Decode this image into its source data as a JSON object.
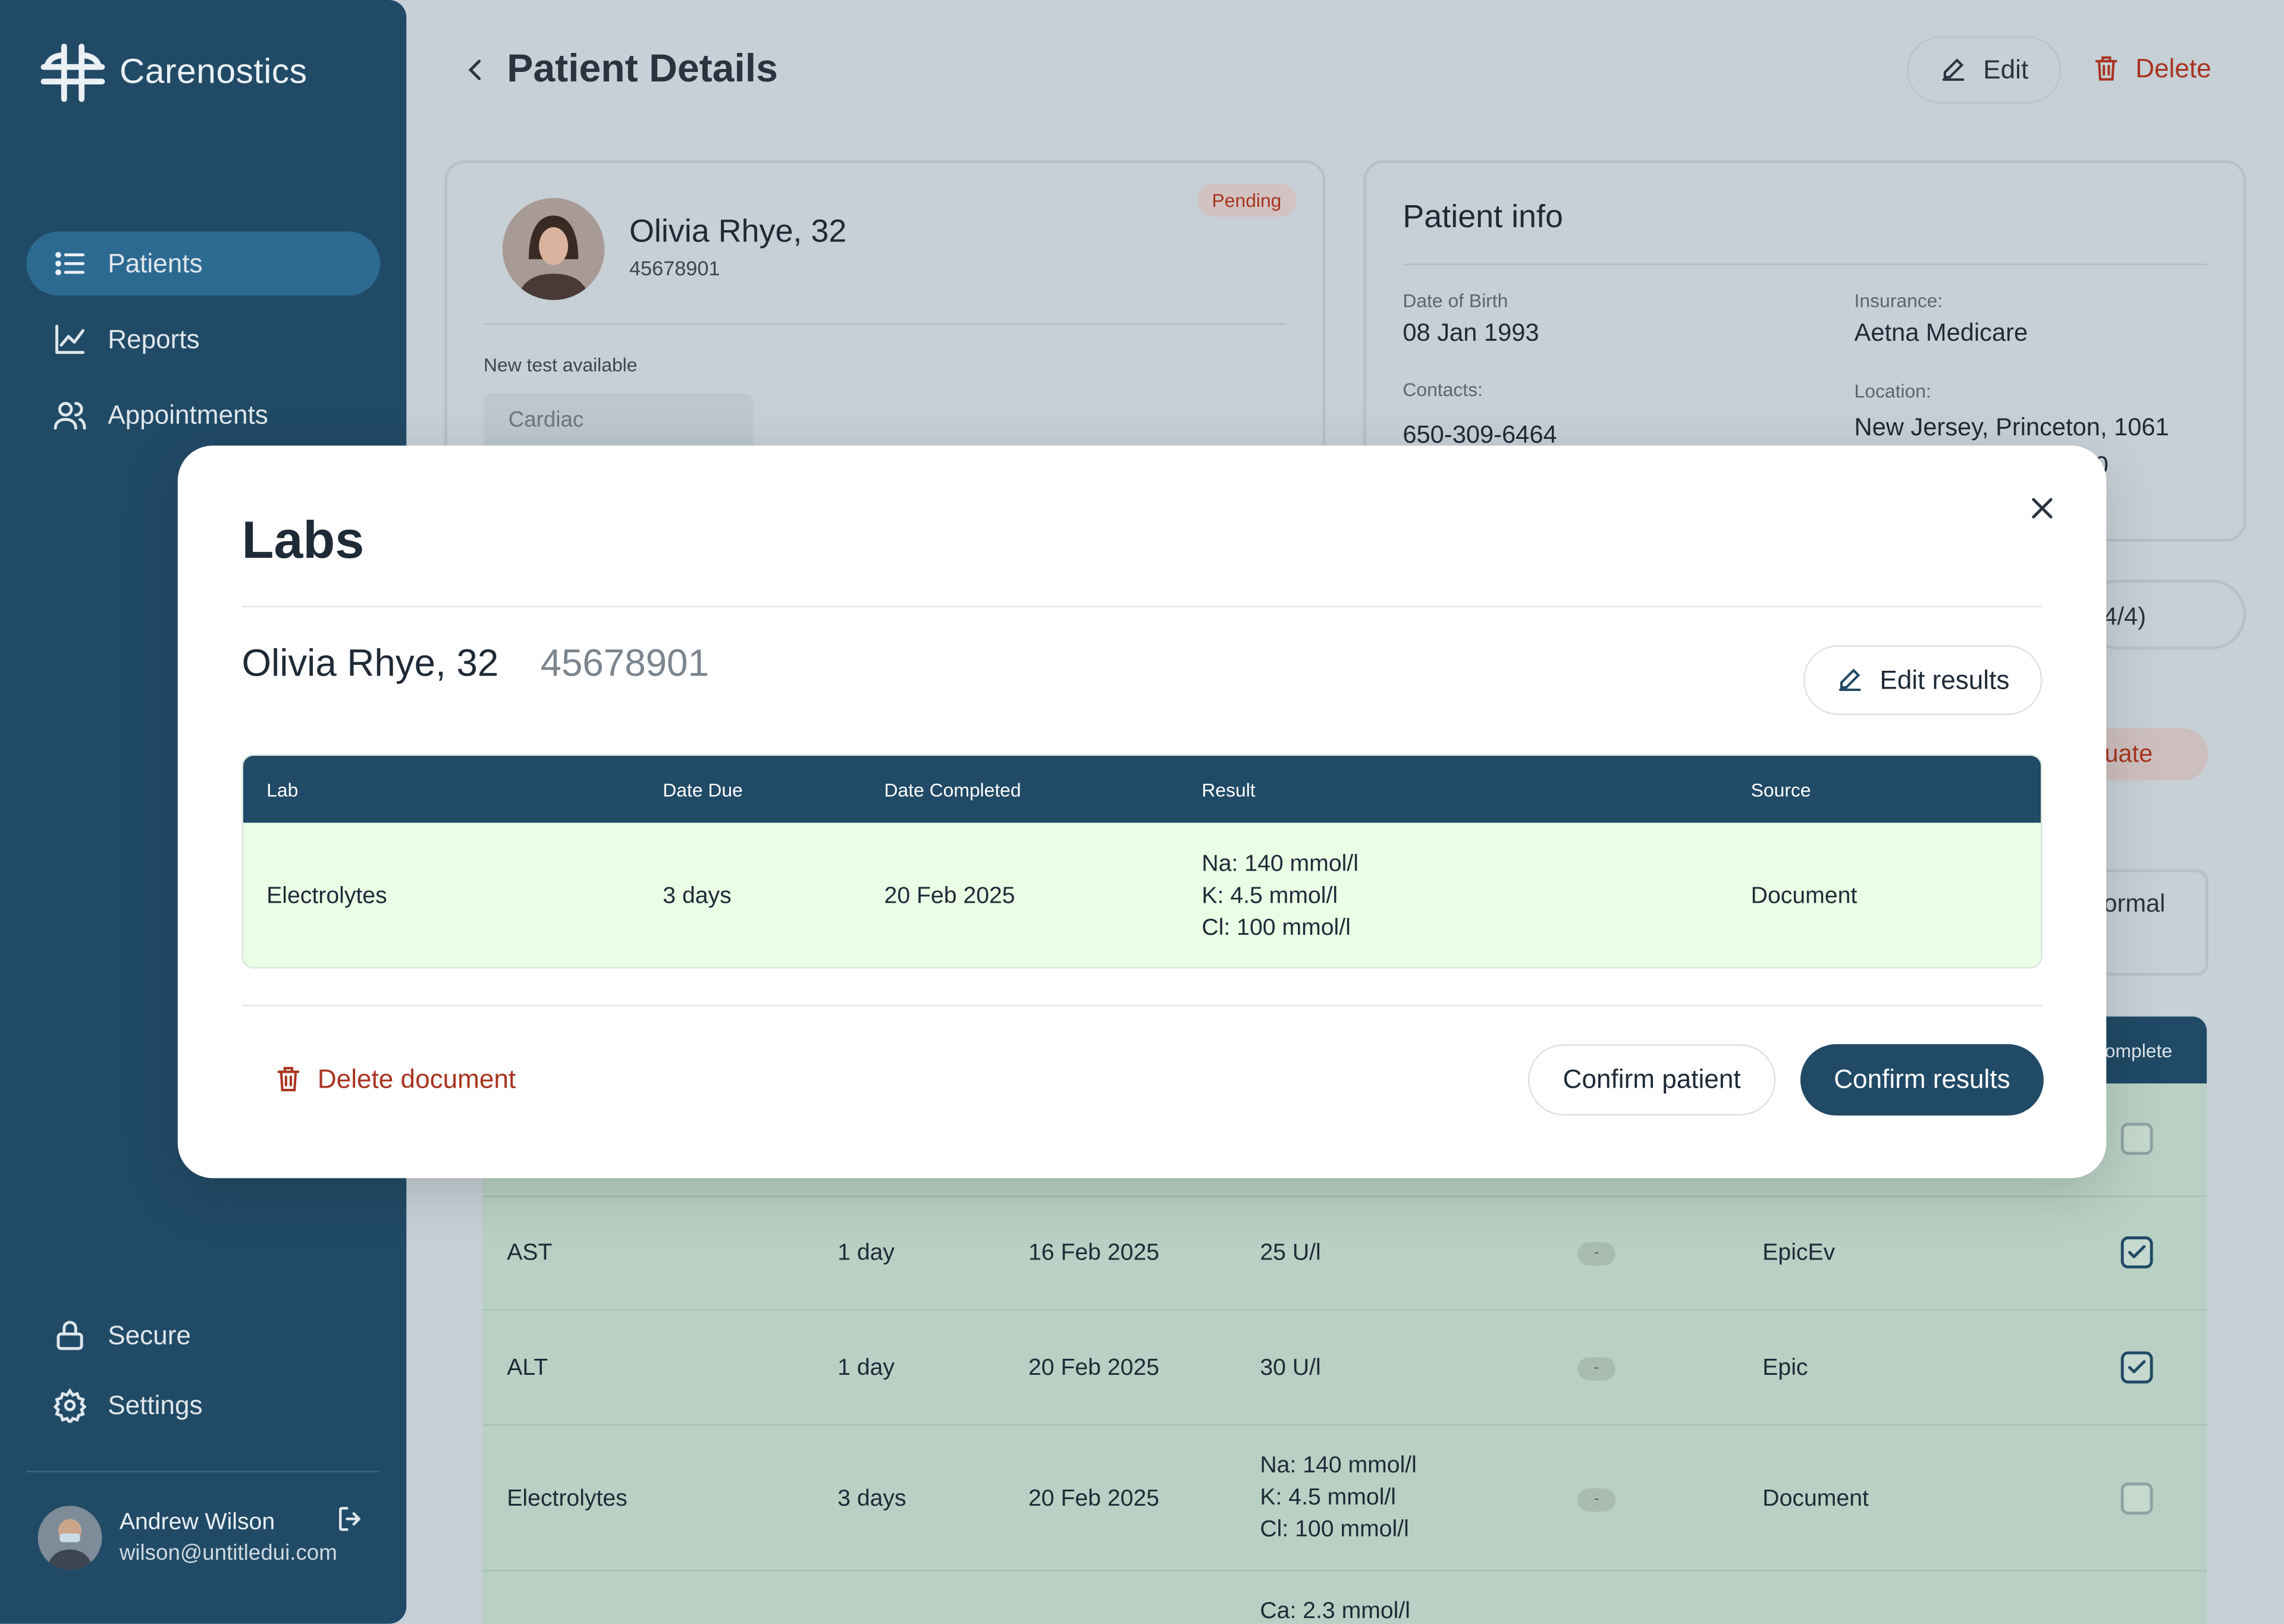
{
  "app": {
    "brand": "Carenostics"
  },
  "sidebar": {
    "items": [
      {
        "label": "Patients",
        "icon": "list-icon",
        "active": true
      },
      {
        "label": "Reports",
        "icon": "chart-icon"
      },
      {
        "label": "Appointments",
        "icon": "users-icon"
      }
    ],
    "bottom_items": [
      {
        "label": "Secure",
        "icon": "lock-icon"
      },
      {
        "label": "Settings",
        "icon": "gear-icon"
      }
    ],
    "user": {
      "name": "Andrew Wilson",
      "email": "wilson@untitledui.com"
    }
  },
  "header": {
    "title": "Patient Details",
    "edit_label": "Edit",
    "delete_label": "Delete"
  },
  "patient_card": {
    "name": "Olivia Rhye, 32",
    "id": "45678901",
    "status": "Pending",
    "new_test_label": "New test available",
    "test_placeholder": "Cardiac"
  },
  "patient_info": {
    "title": "Patient info",
    "dob_label": "Date of Birth",
    "dob": "08 Jan 1993",
    "insurance_label": "Insurance:",
    "insurance": "Aetna Medicare",
    "contacts_label": "Contacts:",
    "contacts": "650-309-6464",
    "location_label": "Location:",
    "location": "New Jersey, Princeton, 1061",
    "location_cont": "0"
  },
  "background_fragments": {
    "tab_fragment": "4/4)",
    "evaluate_fragment": "luate",
    "normal_fragment": "ormal",
    "complete_header_fragment": "omplete"
  },
  "background_table": {
    "rows": [
      {
        "lab": "AST",
        "due": "1 day",
        "completed": "16 Feb 2025",
        "result": [
          "25 U/l"
        ],
        "flag": "-",
        "source": "EpicEv",
        "checked": true
      },
      {
        "lab": "ALT",
        "due": "1 day",
        "completed": "20 Feb 2025",
        "result": [
          "30 U/l"
        ],
        "flag": "-",
        "source": "Epic",
        "checked": true
      },
      {
        "lab": "Electrolytes",
        "due": "3 days",
        "completed": "20 Feb 2025",
        "result": [
          "Na: 140 mmol/l",
          "K: 4.5 mmol/l",
          "Cl: 100 mmol/l"
        ],
        "flag": "-",
        "source": "Document",
        "checked": false
      },
      {
        "lab": "",
        "due": "",
        "completed": "",
        "result": [
          "Ca: 2.3 mmol/l"
        ],
        "flag": "",
        "source": "",
        "checked": false
      }
    ]
  },
  "modal": {
    "title": "Labs",
    "patient_name": "Olivia Rhye, 32",
    "patient_id": "45678901",
    "edit_results_label": "Edit results",
    "columns": [
      "Lab",
      "Date Due",
      "Date Completed",
      "Result",
      "Source"
    ],
    "row": {
      "lab": "Electrolytes",
      "due": "3 days",
      "completed": "20 Feb 2025",
      "result": [
        "Na: 140 mmol/l",
        "K: 4.5 mmol/l",
        "Cl: 100 mmol/l"
      ],
      "source": "Document"
    },
    "delete_label": "Delete document",
    "confirm_patient_label": "Confirm patient",
    "confirm_results_label": "Confirm results"
  },
  "colors": {
    "primary": "#214a66",
    "danger": "#a9341f",
    "success_bg": "#eafee6"
  }
}
